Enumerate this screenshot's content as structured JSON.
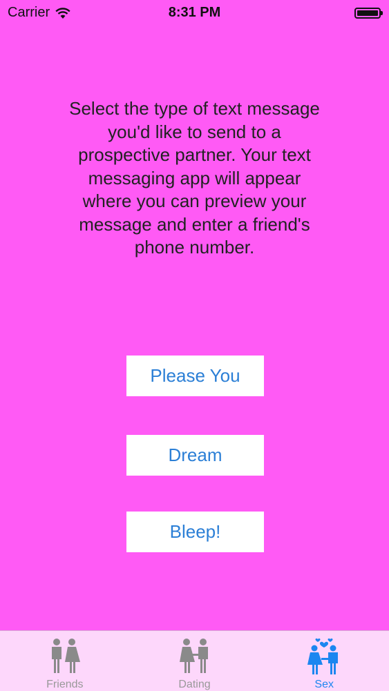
{
  "status_bar": {
    "carrier": "Carrier",
    "time": "8:31 PM",
    "wifi_icon": "wifi-icon",
    "battery_icon": "battery-icon"
  },
  "instructions": "Select the type of text message you'd like to send to a prospective partner. Your text messaging app will appear where you can preview your message and enter a friend's phone number.",
  "buttons": [
    {
      "label": "Please You"
    },
    {
      "label": "Dream"
    },
    {
      "label": "Bleep!"
    }
  ],
  "tabs": [
    {
      "label": "Friends",
      "icon": "friends-icon",
      "active": false
    },
    {
      "label": "Dating",
      "icon": "dating-icon",
      "active": false
    },
    {
      "label": "Sex",
      "icon": "couple-hearts-icon",
      "active": true
    }
  ],
  "colors": {
    "background": "#ff5af5",
    "button_text": "#2b7fd6",
    "tab_active": "#1c86f0",
    "tab_inactive": "#999999"
  }
}
